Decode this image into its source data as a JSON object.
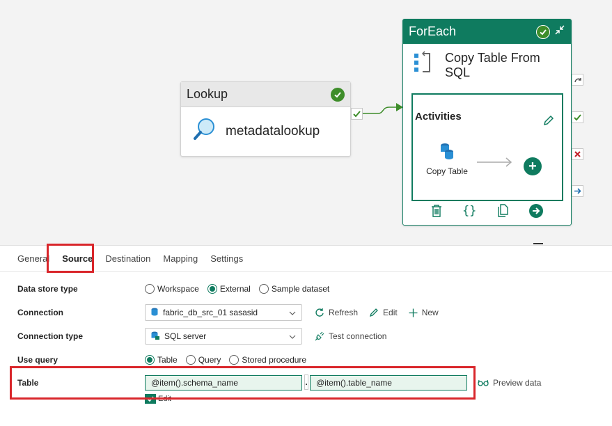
{
  "canvas": {
    "lookup": {
      "header": "Lookup",
      "name": "metadatalookup"
    },
    "foreach": {
      "header": "ForEach",
      "activity_name": "Copy Table From SQL",
      "activities_title": "Activities",
      "inner_activity_label": "Copy Table"
    }
  },
  "tabs": [
    {
      "label": "General"
    },
    {
      "label": "Source"
    },
    {
      "label": "Destination"
    },
    {
      "label": "Mapping"
    },
    {
      "label": "Settings"
    }
  ],
  "form": {
    "data_store_type": {
      "label": "Data store type",
      "options": [
        "Workspace",
        "External",
        "Sample dataset"
      ],
      "selected": "External"
    },
    "connection": {
      "label": "Connection",
      "value": "fabric_db_src_01 sasasid",
      "refresh": "Refresh",
      "edit": "Edit",
      "new": "New"
    },
    "connection_type": {
      "label": "Connection type",
      "value": "SQL server",
      "test": "Test connection"
    },
    "use_query": {
      "label": "Use query",
      "options": [
        "Table",
        "Query",
        "Stored procedure"
      ],
      "selected": "Table"
    },
    "table": {
      "label": "Table",
      "schema": "@item().schema_name",
      "separator": ".",
      "table": "@item().table_name",
      "preview": "Preview data",
      "edit": "Edit"
    }
  },
  "colors": {
    "accent": "#0f7b5f",
    "highlight": "#d9262b",
    "success": "#3e8d2a"
  }
}
